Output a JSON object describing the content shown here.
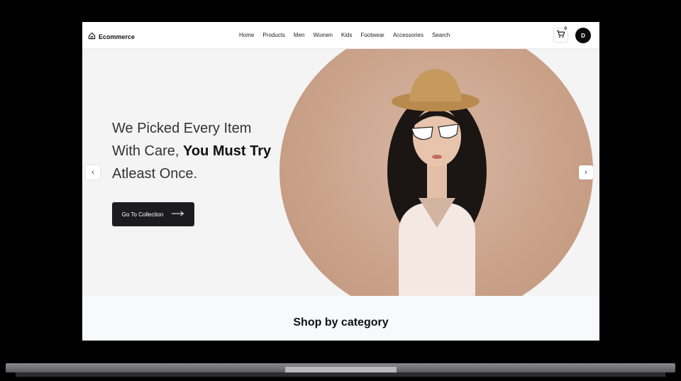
{
  "app": {
    "brand": "Ecommerce",
    "brand_icon": "home-icon"
  },
  "nav": {
    "items": [
      "Home",
      "Products",
      "Men",
      "Women",
      "Kids",
      "Footwear",
      "Accessories",
      "Search"
    ]
  },
  "cart": {
    "count": "0",
    "icon": "cart-icon"
  },
  "user": {
    "initial": "D"
  },
  "hero": {
    "line1": "We Picked Every Item",
    "line2_prefix": "With Care, ",
    "line2_bold": "You Must Try",
    "line3": "Atleast Once.",
    "cta_label": "Go To Collection",
    "prev_icon": "chevron-left-icon",
    "next_icon": "chevron-right-icon"
  },
  "section": {
    "title": "Shop by category"
  },
  "colors": {
    "cta_bg": "#1c1c1e",
    "hero_bg": "#f4f4f4",
    "circle": "#caa28a"
  }
}
